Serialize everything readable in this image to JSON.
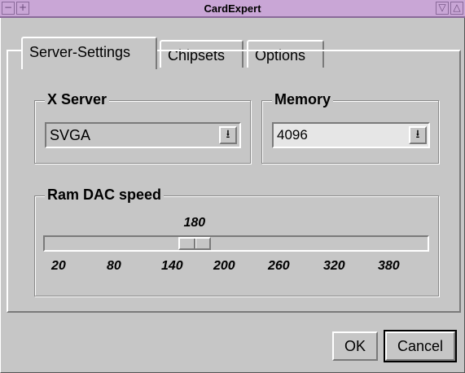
{
  "window": {
    "title": "CardExpert",
    "title_bar_color": "#c9a6d6",
    "left_buttons": [
      "minus-icon",
      "plus-icon"
    ],
    "right_buttons": [
      "triangle-down-icon",
      "triangle-up-icon"
    ]
  },
  "tabs": [
    {
      "label": "Server-Settings",
      "active": true
    },
    {
      "label": "Chipsets",
      "active": false
    },
    {
      "label": "Options",
      "active": false
    }
  ],
  "x_server": {
    "title": "X Server",
    "value": "SVGA",
    "dropdown_icon": "down-arrow-icon"
  },
  "memory": {
    "title": "Memory",
    "value": "4096",
    "dropdown_icon": "down-arrow-icon"
  },
  "ram_dac": {
    "title": "Ram DAC speed",
    "current_value": "180",
    "current": 180,
    "min": 20,
    "max": 440,
    "tick_labels": [
      "20",
      "80",
      "140",
      "200",
      "260",
      "320",
      "380"
    ]
  },
  "buttons": {
    "ok": "OK",
    "cancel": "Cancel"
  }
}
